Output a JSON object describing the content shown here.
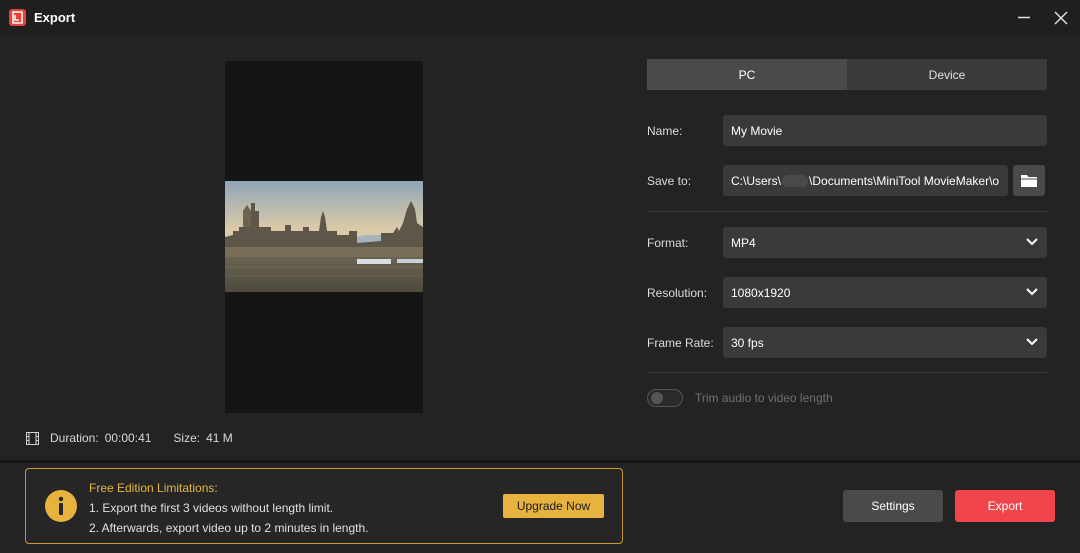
{
  "window": {
    "title": "Export",
    "logo_icon": "minitool-moviemaker-logo-icon",
    "minimize_icon": "minimize-icon",
    "close_icon": "close-icon"
  },
  "preview": {
    "image_subject": "Houses of Parliament on the river",
    "duration_label": "Duration:",
    "duration_value": "00:00:41",
    "size_label": "Size:",
    "size_value": "41 M"
  },
  "tabs": [
    {
      "label": "PC",
      "active": true
    },
    {
      "label": "Device",
      "active": false
    }
  ],
  "form": {
    "name_label": "Name:",
    "name_value": "My Movie",
    "save_label": "Save to:",
    "save_path_prefix": "C:\\Users\\",
    "save_path_suffix": "\\Documents\\MiniTool MovieMaker\\o",
    "format_label": "Format:",
    "format_value": "MP4",
    "resolution_label": "Resolution:",
    "resolution_value": "1080x1920",
    "framerate_label": "Frame Rate:",
    "framerate_value": "30 fps",
    "trim_label": "Trim audio to video length",
    "trim_enabled": false
  },
  "limits": {
    "title": "Free Edition Limitations:",
    "line1": "1. Export the first 3 videos without length limit.",
    "line2": "2. Afterwards, export video up to 2 minutes in length.",
    "upgrade_label": "Upgrade Now"
  },
  "buttons": {
    "settings_label": "Settings",
    "export_label": "Export"
  },
  "colors": {
    "accent_red": "#f0454a",
    "warning_gold": "#e8b23e",
    "background": "#232323"
  }
}
